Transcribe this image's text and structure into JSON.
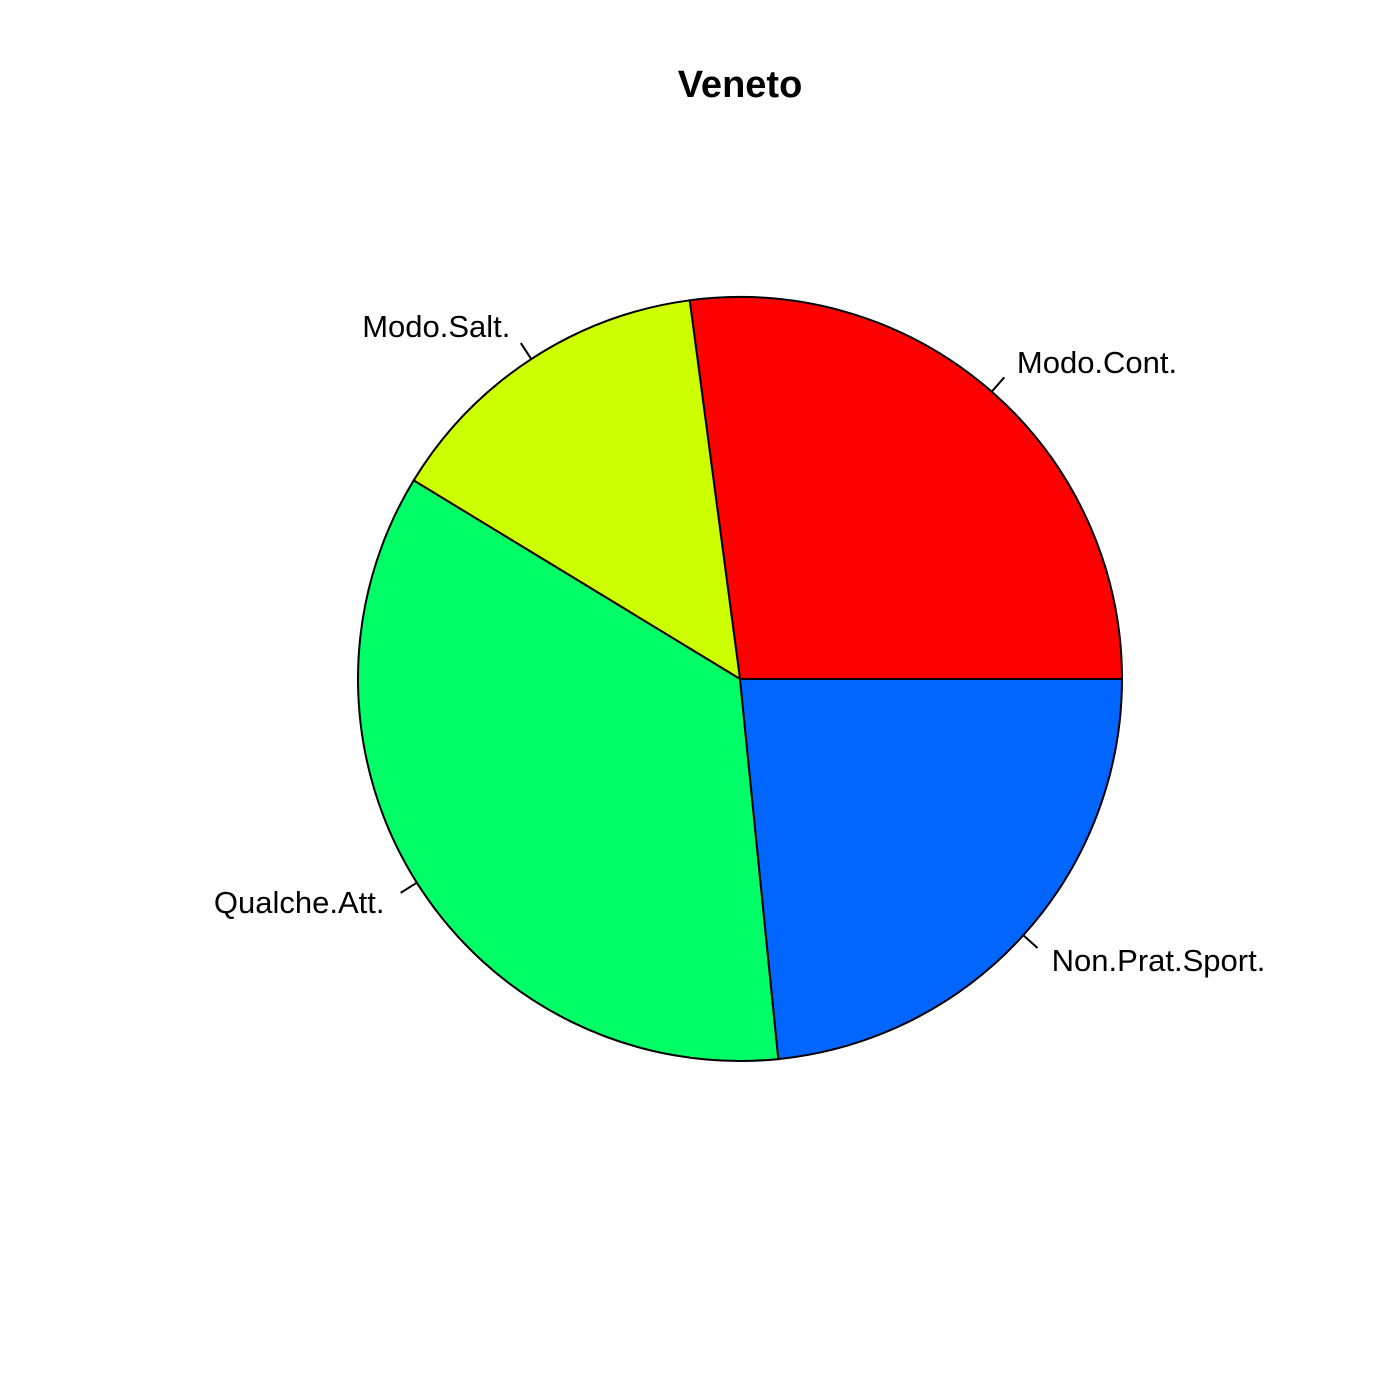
{
  "chart_data": {
    "type": "pie",
    "title": "Veneto",
    "start_angle_deg": 0,
    "direction": "counterclockwise",
    "slices": [
      {
        "label": "Modo.Cont.",
        "value": 27.1,
        "color": "#FF0000"
      },
      {
        "label": "Modo.Salt.",
        "value": 14.2,
        "color": "#CCFF00"
      },
      {
        "label": "Qualche.Att.",
        "value": 35.3,
        "color": "#00FF66"
      },
      {
        "label": "Non.Prat.Sport.",
        "value": 23.4,
        "color": "#0066FF"
      }
    ]
  }
}
